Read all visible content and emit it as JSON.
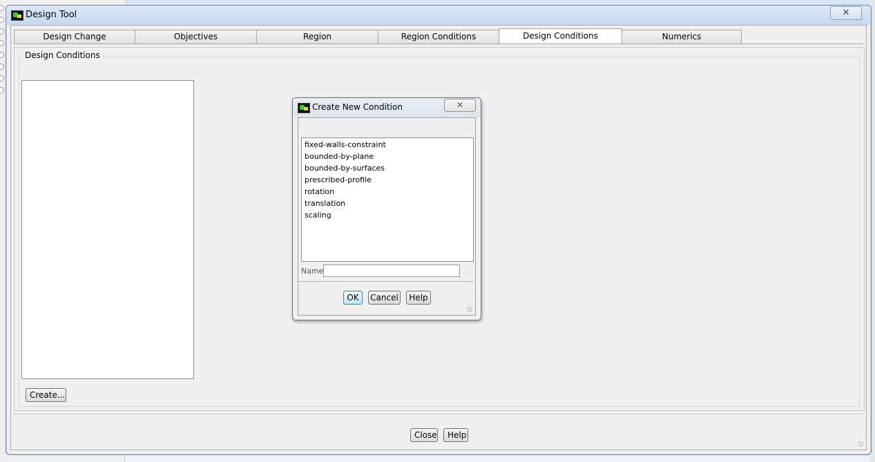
{
  "main_window": {
    "title": "Design Tool",
    "close_glyph": "✕",
    "icon": "fluent-app-icon"
  },
  "tabs": [
    {
      "label": "Design Change"
    },
    {
      "label": "Objectives"
    },
    {
      "label": "Region"
    },
    {
      "label": "Region Conditions"
    },
    {
      "label": "Design Conditions",
      "active": true
    },
    {
      "label": "Numerics"
    }
  ],
  "design_conditions": {
    "group_label": "Design Conditions",
    "create_button": "Create..."
  },
  "footer": {
    "close_button": "Close",
    "help_button": "Help"
  },
  "dialog": {
    "title": "Create New Condition",
    "close_glyph": "✕",
    "options": [
      "fixed-walls-constraint",
      "bounded-by-plane",
      "bounded-by-surfaces",
      "prescribed-profile",
      "rotation",
      "translation",
      "scaling"
    ],
    "name_label": "Name",
    "name_value": "",
    "ok_button": "OK",
    "cancel_button": "Cancel",
    "help_button": "Help"
  },
  "colors": {
    "titlebar": "#c7d9f0",
    "window_bg": "#f0f0f0",
    "focus_border": "#3c7fb1"
  }
}
